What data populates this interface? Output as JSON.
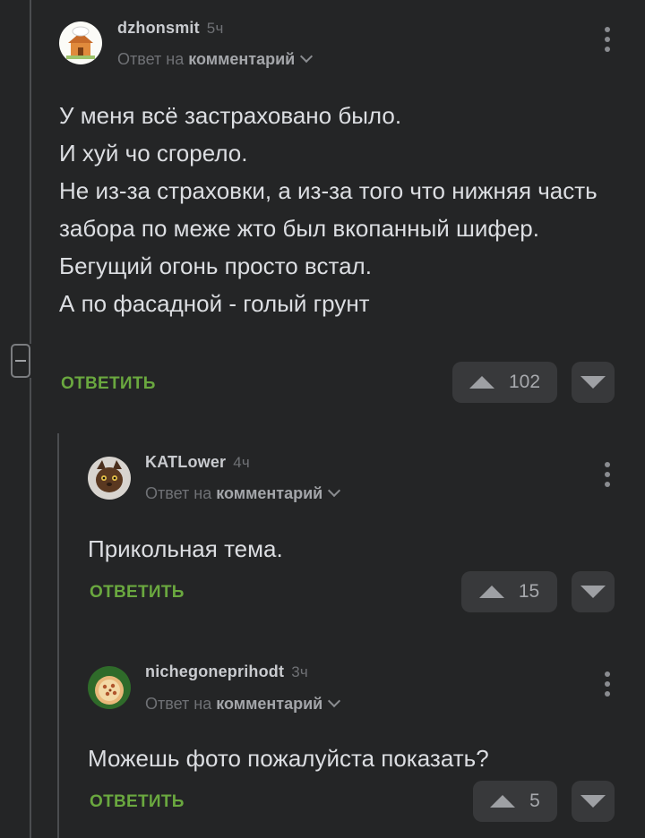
{
  "comments": [
    {
      "username": "dzhonsmit",
      "time": "5ч",
      "reply_prefix": "Ответ на",
      "reply_target": "комментарий",
      "text": "У меня всё застраховано было.\nИ хуй чо сгорело.\nНе из-за страховки, а из-за того что нижняя часть забора по меже жто был вкопанный шифер.\nБегущий огонь просто встал.\nА по фасадной - голый грунт",
      "reply_label": "ОТВЕТИТЬ",
      "votes": "102",
      "avatar_icon": "chef-house-avatar-icon"
    },
    {
      "username": "KATLower",
      "time": "4ч",
      "reply_prefix": "Ответ на",
      "reply_target": "комментарий",
      "text": "Прикольная тема.",
      "reply_label": "ОТВЕТИТЬ",
      "votes": "15",
      "avatar_icon": "cat-avatar-icon"
    },
    {
      "username": "nichegoneprihodt",
      "time": "3ч",
      "reply_prefix": "Ответ на",
      "reply_target": "комментарий",
      "text": "Можешь фото пожалуйста показать?",
      "reply_label": "ОТВЕТИТЬ",
      "votes": "5",
      "avatar_icon": "pizza-avatar-icon"
    }
  ],
  "colors": {
    "background": "#242526",
    "accent_green": "#6aa83f",
    "button_bg": "#38393b"
  }
}
